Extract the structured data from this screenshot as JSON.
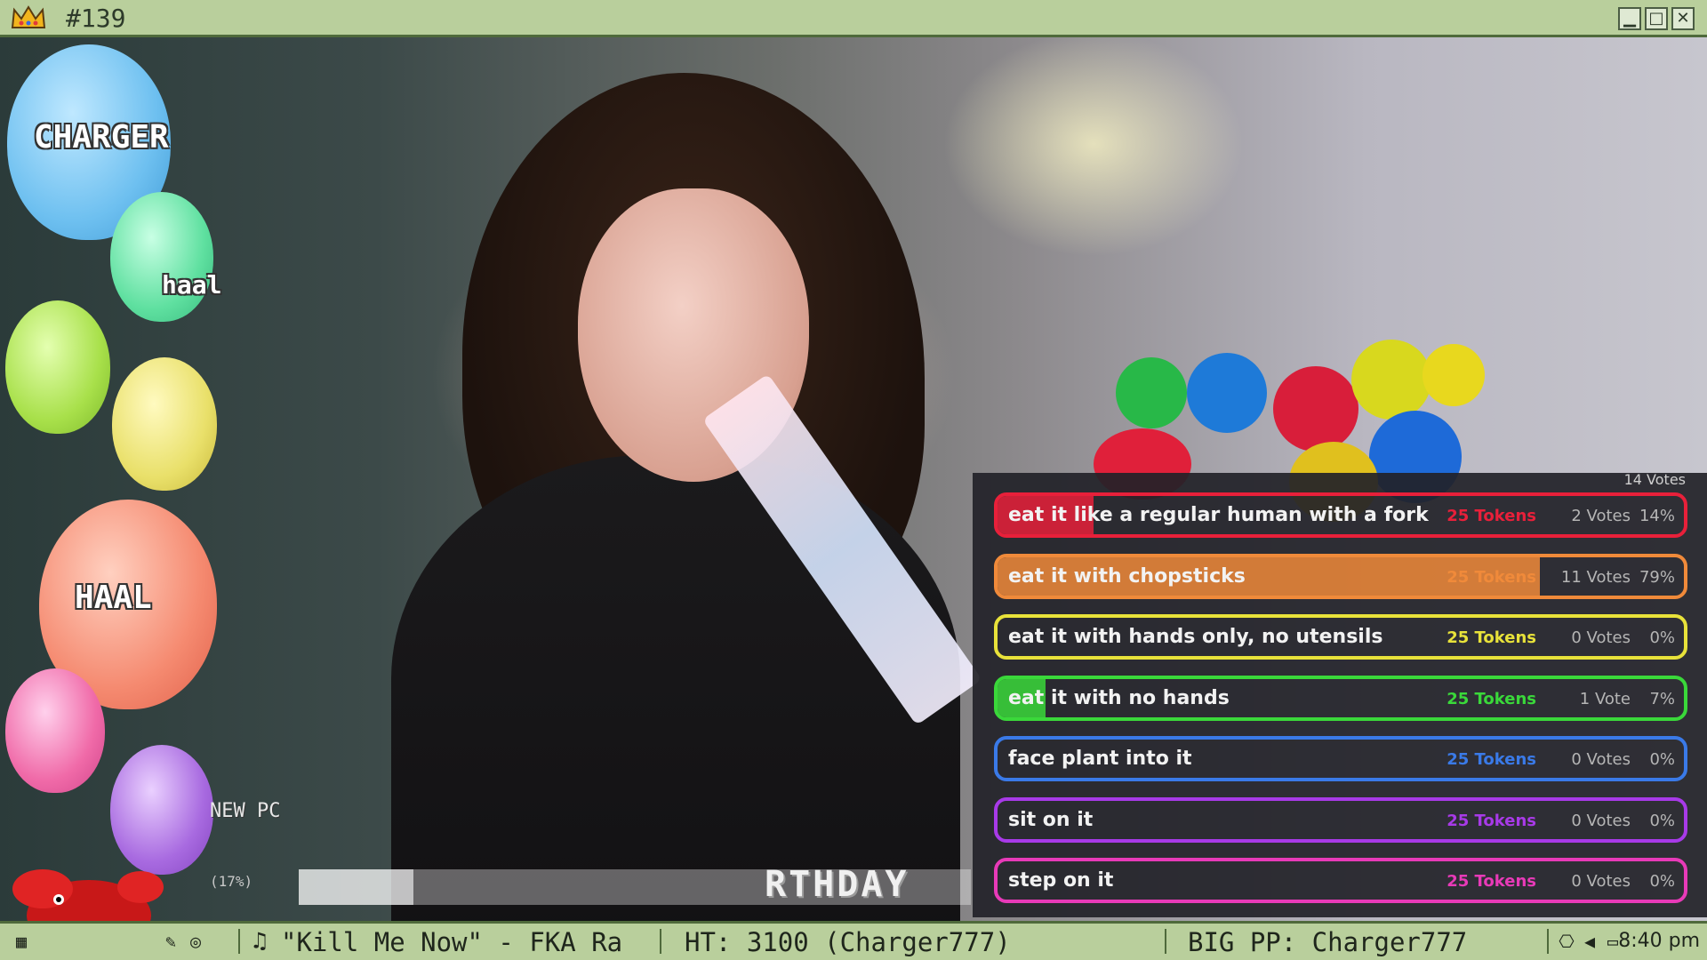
{
  "window": {
    "title": "#139",
    "icon": "crown-icon",
    "buttons": [
      "minimize",
      "maximize",
      "close"
    ]
  },
  "balloons": [
    {
      "label": "CHARGER",
      "color": "#6ec0f0"
    },
    {
      "label": "haal",
      "color": "#5fe0a0"
    },
    {
      "label": "",
      "color": "#a8e04a"
    },
    {
      "label": "",
      "color": "#e9e06a"
    },
    {
      "label": "HAAL",
      "color": "#f58a70"
    },
    {
      "label": "",
      "color": "#f06aa8"
    },
    {
      "label": "",
      "color": "#a86ae0"
    }
  ],
  "goal": {
    "label": "NEW PC",
    "percent_text": "(17%)",
    "banner_text": "RTHDAY",
    "progress": 0.17
  },
  "poll": {
    "header": "14 Votes",
    "options": [
      {
        "label": "eat it like a regular human with a fork",
        "tokens": "25 Tokens",
        "votes": "2 Votes",
        "percent": "14%",
        "share": 0.14,
        "color": "#e8203a"
      },
      {
        "label": "eat it with chopsticks",
        "tokens": "25 Tokens",
        "votes": "11 Votes",
        "percent": "79%",
        "share": 0.79,
        "color": "#f08a3a"
      },
      {
        "label": "eat it with hands only, no utensils",
        "tokens": "25 Tokens",
        "votes": "0 Votes",
        "percent": "0%",
        "share": 0.0,
        "color": "#e8e23a"
      },
      {
        "label": "eat it with no hands",
        "tokens": "25 Tokens",
        "votes": "1 Vote",
        "percent": "7%",
        "share": 0.07,
        "color": "#3ad83a"
      },
      {
        "label": "face plant into it",
        "tokens": "25 Tokens",
        "votes": "0 Votes",
        "percent": "0%",
        "share": 0.0,
        "color": "#3a7ae8"
      },
      {
        "label": "sit on it",
        "tokens": "25 Tokens",
        "votes": "0 Votes",
        "percent": "0%",
        "share": 0.0,
        "color": "#a83ae8"
      },
      {
        "label": "step on it",
        "tokens": "25 Tokens",
        "votes": "0 Votes",
        "percent": "0%",
        "share": 0.0,
        "color": "#e83ab8"
      }
    ]
  },
  "taskbar": {
    "now_playing": "\"Kill Me Now\" - FKA Ra",
    "high_tip": "HT: 3100 (Charger777)",
    "big_pp": "BIG PP: Charger777",
    "clock": "8:40 pm",
    "icons": [
      "music-note-icon",
      "network-icon",
      "speaker-icon",
      "monitor-icon"
    ]
  }
}
